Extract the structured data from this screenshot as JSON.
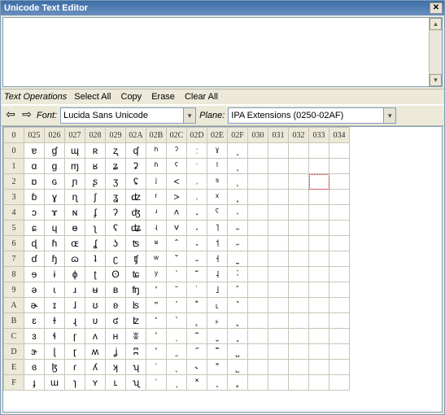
{
  "window": {
    "title": "Unicode Text Editor"
  },
  "menu": {
    "title": "Text Operations",
    "items": [
      "Select All",
      "Copy",
      "Erase",
      "Clear All"
    ]
  },
  "controls": {
    "font_label": "Font:",
    "font_value": "Lucida Sans Unicode",
    "plane_label": "Plane:",
    "plane_value": "IPA Extensions (0250-02AF)"
  },
  "grid": {
    "corner": "0",
    "col_headers": [
      "025",
      "026",
      "027",
      "028",
      "029",
      "02A",
      "02B",
      "02C",
      "02D",
      "02E",
      "02F",
      "030",
      "031",
      "032",
      "033",
      "034"
    ],
    "row_headers": [
      "0",
      "1",
      "2",
      "3",
      "4",
      "5",
      "6",
      "7",
      "8",
      "9",
      "A",
      "B",
      "C",
      "D",
      "E",
      "F"
    ],
    "cells": [
      [
        "ɐ",
        "ɠ",
        "ɰ",
        "ʀ",
        "ʐ",
        "ʠ",
        "ʰ",
        "ˀ",
        "ː",
        "ˠ",
        "˰",
        "",
        "",
        "",
        "",
        ""
      ],
      [
        "ɑ",
        "ɡ",
        "ɱ",
        "ʁ",
        "ʑ",
        "ʡ",
        "ʱ",
        "ˁ",
        "ˑ",
        "ˡ",
        "˱",
        "",
        "",
        "",
        "",
        ""
      ],
      [
        "ɒ",
        "ɢ",
        "ɲ",
        "ʂ",
        "ʒ",
        "ʢ",
        "ʲ",
        "˂",
        "˒",
        "ˢ",
        "˲",
        "",
        "",
        "",
        "",
        ""
      ],
      [
        "ɓ",
        "ɣ",
        "ɳ",
        "ʃ",
        "ʓ",
        "ʣ",
        "ʳ",
        "˃",
        "˓",
        "ˣ",
        "˳",
        "",
        "",
        "",
        "",
        ""
      ],
      [
        "ɔ",
        "ɤ",
        "ɴ",
        "ʄ",
        "ʔ",
        "ʤ",
        "ʴ",
        "˄",
        "˔",
        "ˤ",
        "˴",
        "",
        "",
        "",
        "",
        ""
      ],
      [
        "ɕ",
        "ɥ",
        "ɵ",
        "ʅ",
        "ʕ",
        "ʥ",
        "ʵ",
        "˅",
        "˕",
        "˥",
        "˵",
        "",
        "",
        "",
        "",
        ""
      ],
      [
        "ɖ",
        "ɦ",
        "ɶ",
        "ʆ",
        "ʖ",
        "ʦ",
        "ʶ",
        "ˆ",
        "˖",
        "˦",
        "˶",
        "",
        "",
        "",
        "",
        ""
      ],
      [
        "ɗ",
        "ɧ",
        "ɷ",
        "ʇ",
        "ʗ",
        "ʧ",
        "ʷ",
        "ˇ",
        "˗",
        "˧",
        "˷",
        "",
        "",
        "",
        "",
        ""
      ],
      [
        "ɘ",
        "ɨ",
        "ɸ",
        "ʈ",
        "ʘ",
        "ʨ",
        "ʸ",
        "ˈ",
        "˘",
        "˨",
        "˸",
        "",
        "",
        "",
        "",
        ""
      ],
      [
        "ə",
        "ɩ",
        "ɹ",
        "ʉ",
        "ʙ",
        "ʩ",
        "ʹ",
        "ˉ",
        "˙",
        "˩",
        "˹",
        "",
        "",
        "",
        "",
        ""
      ],
      [
        "ɚ",
        "ɪ",
        "ɺ",
        "ʊ",
        "ʚ",
        "ʪ",
        "ʺ",
        "ˊ",
        "˚",
        "˪",
        "˺",
        "",
        "",
        "",
        "",
        ""
      ],
      [
        "ɛ",
        "ɫ",
        "ɻ",
        "ʋ",
        "ʛ",
        "ʫ",
        "ʻ",
        "ˋ",
        "˛",
        "˫",
        "˻",
        "",
        "",
        "",
        "",
        ""
      ],
      [
        "ɜ",
        "ɬ",
        "ɼ",
        "ʌ",
        "ʜ",
        "ʬ",
        "ʼ",
        "ˌ",
        "˜",
        "ˬ",
        "˼",
        "",
        "",
        "",
        "",
        ""
      ],
      [
        "ɝ",
        "ɭ",
        "ɽ",
        "ʍ",
        "ʝ",
        "ʭ",
        "ʽ",
        "ˍ",
        "˝",
        "˭",
        "˽",
        "",
        "",
        "",
        "",
        ""
      ],
      [
        "ɞ",
        "ɮ",
        "ɾ",
        "ʎ",
        "ʞ",
        "ʮ",
        "ʾ",
        "ˎ",
        "˞",
        "ˮ",
        "˾",
        "",
        "",
        "",
        "",
        ""
      ],
      [
        "ɟ",
        "ɯ",
        "ɿ",
        "ʏ",
        "ʟ",
        "ʯ",
        "ʿ",
        "ˏ",
        "˟",
        "˯",
        "˿",
        "",
        "",
        "",
        "",
        ""
      ]
    ],
    "selected": {
      "row": 2,
      "col": 14
    }
  }
}
